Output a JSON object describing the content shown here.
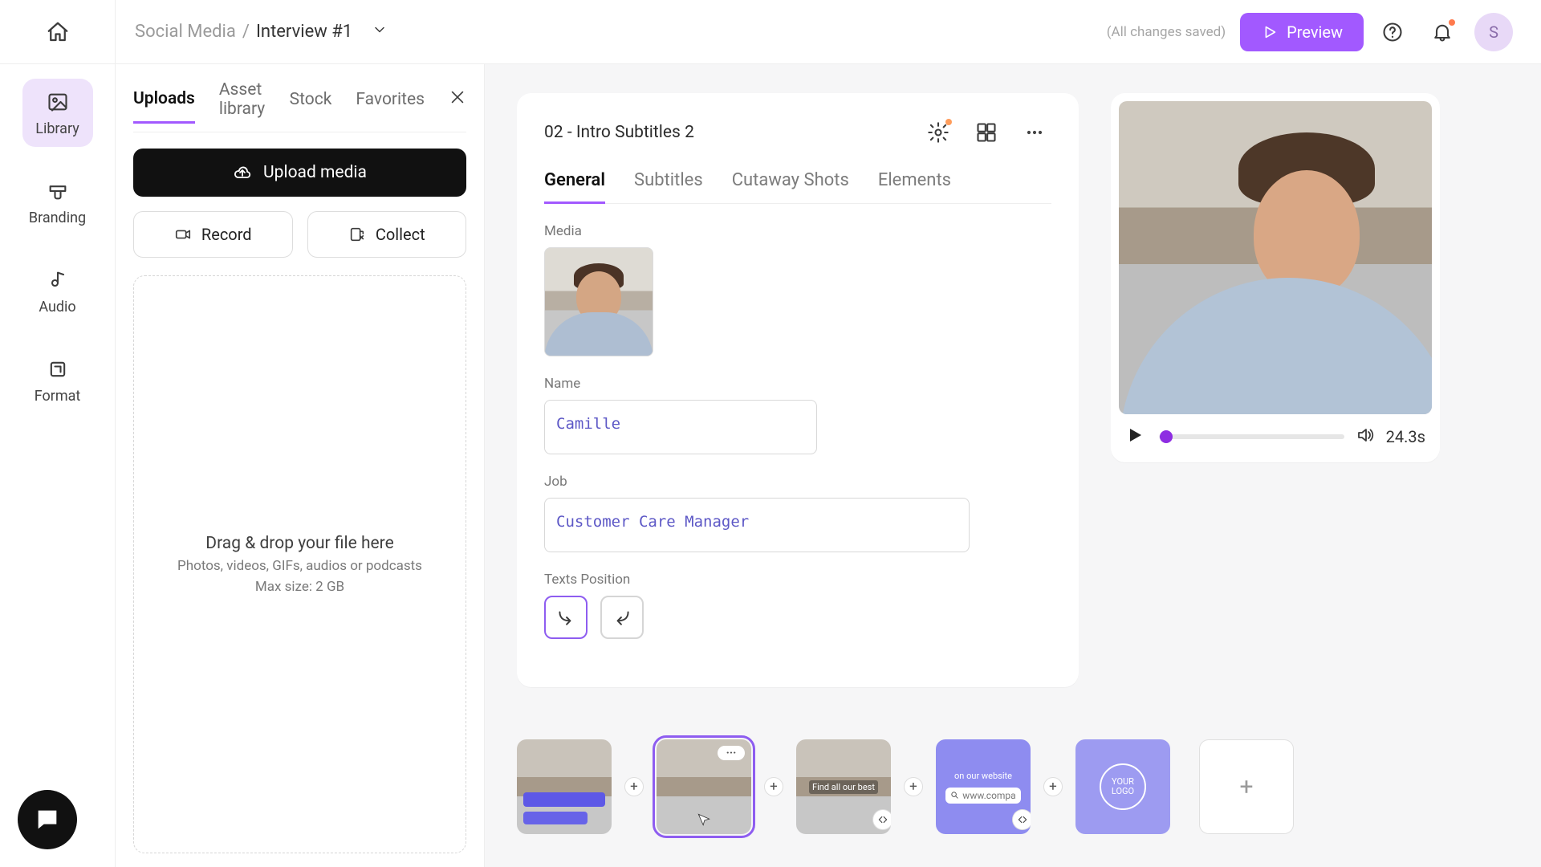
{
  "header": {
    "breadcrumb_folder": "Social Media",
    "breadcrumb_sep": "/",
    "breadcrumb_title": "Interview #1",
    "saved": "(All changes saved)",
    "preview": "Preview",
    "avatar_initial": "S"
  },
  "rail": {
    "library": "Library",
    "branding": "Branding",
    "audio": "Audio",
    "format": "Format"
  },
  "library": {
    "tabs": {
      "uploads": "Uploads",
      "asset": "Asset library",
      "stock": "Stock",
      "favorites": "Favorites"
    },
    "upload": "Upload media",
    "record": "Record",
    "collect": "Collect",
    "dz_title": "Drag & drop your file here",
    "dz_sub1": "Photos, videos, GIFs, audios or podcasts",
    "dz_sub2": "Max size: 2 GB"
  },
  "editor": {
    "clip_title": "02 - Intro Subtitles 2",
    "tabs": {
      "general": "General",
      "subtitles": "Subtitles",
      "cutaway": "Cutaway Shots",
      "elements": "Elements"
    },
    "labels": {
      "media": "Media",
      "name": "Name",
      "job": "Job",
      "texts_position": "Texts Position"
    },
    "values": {
      "name": "Camille",
      "job": "Customer Care Manager"
    }
  },
  "player": {
    "duration": "24.3s"
  },
  "timeline": {
    "clip3_text": "Find all our best",
    "clip4_top": "on our website",
    "clip4_search": "www.compa",
    "clip5_logo": "YOUR LOGO"
  }
}
